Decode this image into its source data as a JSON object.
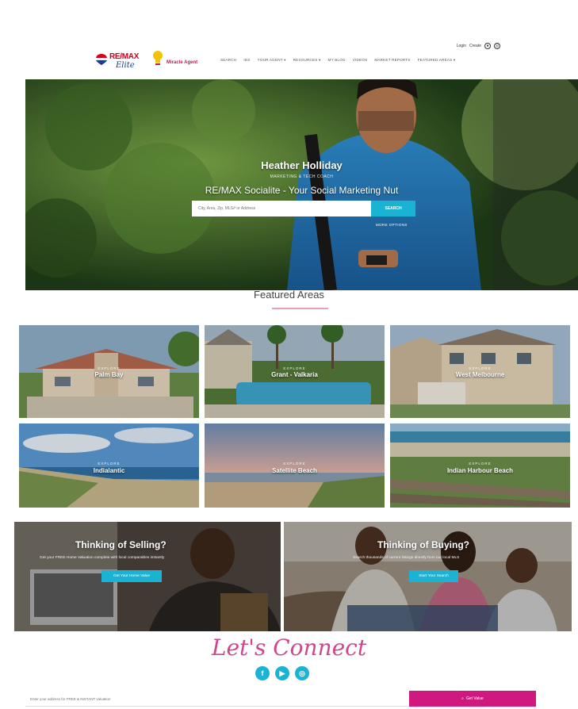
{
  "header": {
    "utility": {
      "login": "Login",
      "create": "Create"
    },
    "brand": {
      "name": "RE/MAX",
      "sub": "Elite"
    },
    "agent_brand": "Miracle Agent",
    "nav": [
      "Search",
      "IDX",
      "Your Agent ▾",
      "Resources ▾",
      "My Blog",
      "Videos",
      "Market Reports",
      "Featured Areas ▾"
    ]
  },
  "hero": {
    "name": "Heather Holliday",
    "subtitle": "MARKETING & TECH COACH",
    "tagline": "RE/MAX Socialite - Your Social Marketing Nut",
    "search_placeholder": "City, Area, Zip, MLS# or Address",
    "search_button": "SEARCH",
    "more_options": "MORE OPTIONS"
  },
  "featured": {
    "title": "Featured Areas",
    "explore_label": "EXPLORE",
    "areas": [
      "Palm Bay",
      "Grant - Valkaria",
      "West Melbourne",
      "Indialantic",
      "Satellite Beach",
      "Indian Harbour Beach"
    ]
  },
  "selling": {
    "title": "Thinking of Selling?",
    "desc": "Get your FREE Home Valuation complete with local comparables instantly",
    "button": "Get Your Home Value"
  },
  "buying": {
    "title": "Thinking of Buying?",
    "desc": "Search thousands of current listings directly from our local MLS",
    "button": "Start Your Search"
  },
  "connect": {
    "title": "Let's Connect",
    "socials": [
      "facebook-icon",
      "youtube-icon",
      "instagram-icon"
    ],
    "valuation_placeholder": "Enter your address for FREE & INSTANT valuation",
    "value_button": "Get Value"
  },
  "colors": {
    "accent": "#1bb3d4",
    "brand_pink": "#d0197f",
    "remax_red": "#d6001c"
  }
}
